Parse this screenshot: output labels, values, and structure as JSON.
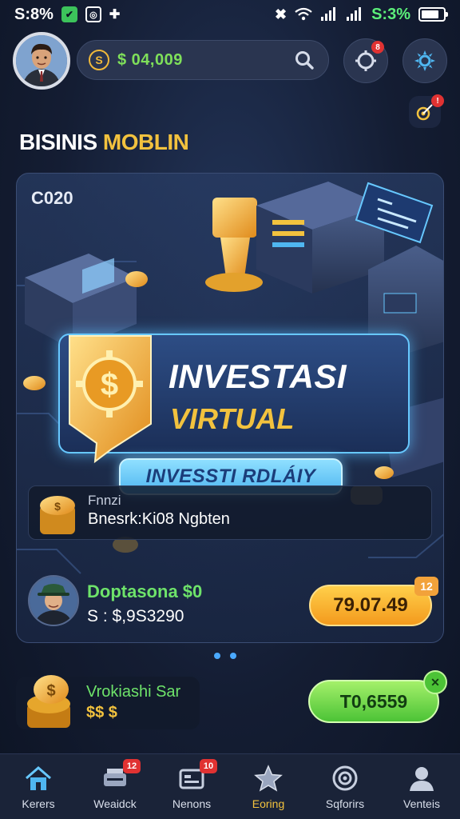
{
  "status_bar": {
    "time": "S:8%",
    "battery_text": "S:3%"
  },
  "header": {
    "balance": "$ 04,009",
    "coin_symbol": "S"
  },
  "header_badges": {
    "notifications": "8"
  },
  "section_title": {
    "part1": "BISINIS ",
    "part2": "MOBLIN"
  },
  "hero": {
    "year": "C020",
    "title": "INVESTASI",
    "subtitle": "VIRTUAL",
    "cta_label": "INVESSTI RDLÁIY"
  },
  "info": {
    "small": "Fnnzi",
    "main": "Bnesrk:Ki08 Ngbten"
  },
  "player": {
    "name": "Doptasona  $0",
    "balance": "S : $,9S3290",
    "button_label": "79.07.49",
    "button_badge": "12"
  },
  "bottom_card": {
    "title": "Vrokiashi Sar",
    "sub": "$$ $"
  },
  "green_button": {
    "label": "T0,6559"
  },
  "nav": {
    "items": [
      {
        "label": "Kerers",
        "icon": "home-icon",
        "badge": ""
      },
      {
        "label": "Weaidck",
        "icon": "tools-icon",
        "badge": "12"
      },
      {
        "label": "Nenons",
        "icon": "store-icon",
        "badge": "10"
      },
      {
        "label": "Eoring",
        "icon": "star-icon",
        "badge": ""
      },
      {
        "label": "Sqforirs",
        "icon": "target-icon",
        "badge": ""
      },
      {
        "label": "Venteis",
        "icon": "profile-icon",
        "badge": ""
      }
    ],
    "active_index": 3
  },
  "colors": {
    "accent_gold": "#f2c23e",
    "accent_green": "#6ee36a",
    "accent_blue": "#67c8ff",
    "bg": "#141d33"
  }
}
